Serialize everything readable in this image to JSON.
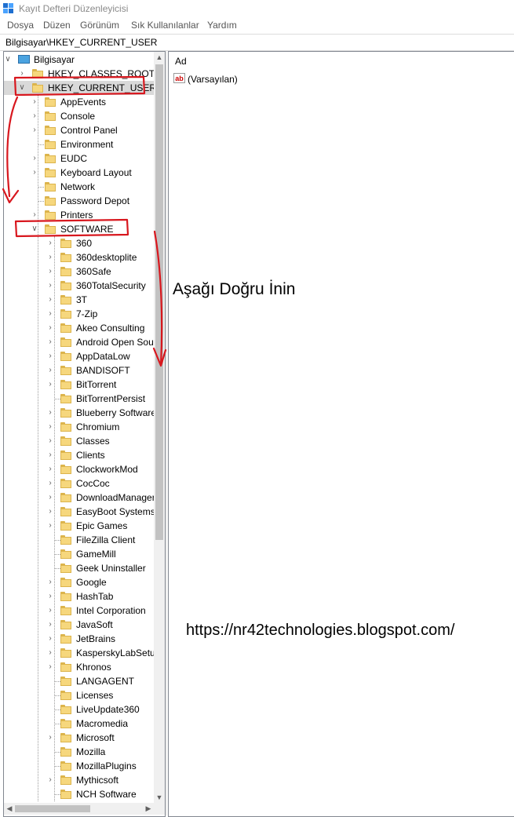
{
  "window": {
    "title": "Kayıt Defteri Düzenleyicisi"
  },
  "menu": [
    "Dosya",
    "Düzen",
    "Görünüm",
    "Sık Kullanılanlar",
    "Yardım"
  ],
  "address": "Bilgisayar\\HKEY_CURRENT_USER",
  "tree": {
    "root": "Bilgisayar",
    "top": [
      "HKEY_CLASSES_ROOT",
      "HKEY_CURRENT_USER"
    ],
    "hkcu_children": [
      "AppEvents",
      "Console",
      "Control Panel",
      "Environment",
      "EUDC",
      "Keyboard Layout",
      "Network",
      "Password Depot",
      "Printers",
      "SOFTWARE"
    ],
    "software_children": [
      "360",
      "360desktoplite",
      "360Safe",
      "360TotalSecurity",
      "3T",
      "7-Zip",
      "Akeo Consulting",
      "Android Open Sou",
      "AppDataLow",
      "BANDISOFT",
      "BitTorrent",
      "BitTorrentPersist",
      "Blueberry Software",
      "Chromium",
      "Classes",
      "Clients",
      "ClockworkMod",
      "CocCoc",
      "DownloadManager",
      "EasyBoot Systems",
      "Epic Games",
      "FileZilla Client",
      "GameMill",
      "Geek Uninstaller",
      "Google",
      "HashTab",
      "Intel Corporation",
      "JavaSoft",
      "JetBrains",
      "KasperskyLabSetup",
      "Khronos",
      "LANGAGENT",
      "Licenses",
      "LiveUpdate360",
      "Macromedia",
      "Microsoft",
      "Mozilla",
      "MozillaPlugins",
      "Mythicsoft",
      "NCH Software"
    ]
  },
  "values_pane": {
    "column_header": "Ad",
    "rows": [
      {
        "name": "(Varsayılan)"
      }
    ]
  },
  "annotations": {
    "instruction": "Aşağı Doğru İnin",
    "url": "https://nr42technologies.blogspot.com/"
  },
  "colors": {
    "annotation_red": "#d8171e",
    "folder": "#f6d77d",
    "selection": "#d9d9d9"
  }
}
